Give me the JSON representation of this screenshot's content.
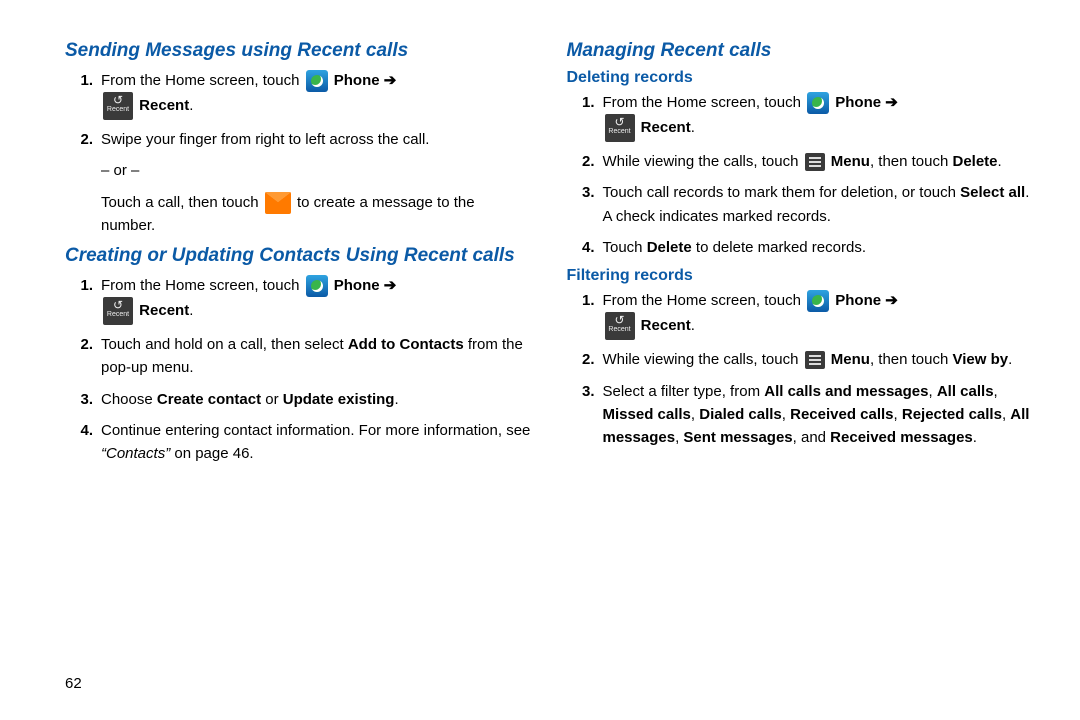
{
  "page_number": "62",
  "arrow": "➔",
  "labels": {
    "phone": "Phone",
    "recent": "Recent",
    "menu": "Menu"
  },
  "left": {
    "sec1": {
      "title": "Sending Messages using Recent calls",
      "s1a": "From the Home screen, touch ",
      "s1c": ".",
      "s2": "Swipe your finger from right to left across the call.",
      "or": "– or –",
      "s2b_a": "Touch a call, then touch ",
      "s2b_b": " to create a message to the number."
    },
    "sec2": {
      "title": "Creating or Updating Contacts Using Recent calls",
      "s1a": "From the Home screen, touch ",
      "s1c": ".",
      "s2a": "Touch and hold on a call, then select ",
      "s2a_bold": "Add to Contacts",
      "s2b": " from the pop-up menu.",
      "s3a": "Choose ",
      "s3b1": "Create contact",
      "s3m": " or ",
      "s3b2": "Update existing",
      "s3c": ".",
      "s4a": "Continue entering contact information. For more information, see ",
      "s4q": "“Contacts”",
      "s4b": " on page 46."
    }
  },
  "right": {
    "title": "Managing Recent calls",
    "del": {
      "title": "Deleting records",
      "s1a": "From the Home screen, touch ",
      "s1c": ".",
      "s2a": "While viewing the calls, touch ",
      "s2b": ", then touch ",
      "s2bold": "Delete",
      "s2c": ".",
      "s3a": "Touch call records to mark them for deletion, or touch ",
      "s3bold": "Select all",
      "s3b": ". A check indicates marked records.",
      "s4a": "Touch ",
      "s4bold": "Delete",
      "s4b": " to delete marked records."
    },
    "filt": {
      "title": "Filtering records",
      "s1a": "From the Home screen, touch ",
      "s1c": ".",
      "s2a": "While viewing the calls, touch ",
      "s2b": ", then touch ",
      "s2bold": "View by",
      "s2c": ".",
      "s3a": "Select a filter type, from ",
      "s3_1": "All calls and messages",
      "s3_2": "All calls",
      "s3_3": "Missed calls",
      "s3_4": "Dialed calls",
      "s3_5": "Received calls",
      "s3_6": "Rejected calls",
      "s3_7": "All messages",
      "s3_8": "Sent messages",
      "s3_and": ", and ",
      "s3_9": "Received messages",
      "s3_end": "."
    }
  }
}
